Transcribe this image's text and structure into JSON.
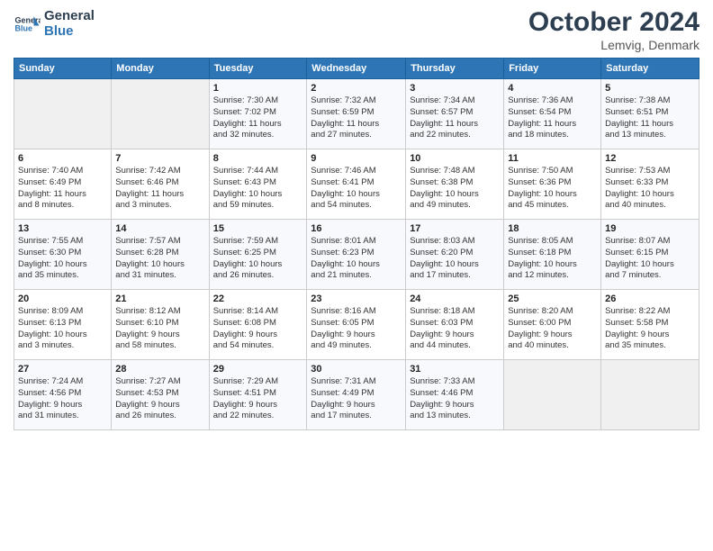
{
  "header": {
    "logo_line1": "General",
    "logo_line2": "Blue",
    "month": "October 2024",
    "location": "Lemvig, Denmark"
  },
  "weekdays": [
    "Sunday",
    "Monday",
    "Tuesday",
    "Wednesday",
    "Thursday",
    "Friday",
    "Saturday"
  ],
  "weeks": [
    [
      {
        "day": "",
        "info": ""
      },
      {
        "day": "",
        "info": ""
      },
      {
        "day": "1",
        "info": "Sunrise: 7:30 AM\nSunset: 7:02 PM\nDaylight: 11 hours\nand 32 minutes."
      },
      {
        "day": "2",
        "info": "Sunrise: 7:32 AM\nSunset: 6:59 PM\nDaylight: 11 hours\nand 27 minutes."
      },
      {
        "day": "3",
        "info": "Sunrise: 7:34 AM\nSunset: 6:57 PM\nDaylight: 11 hours\nand 22 minutes."
      },
      {
        "day": "4",
        "info": "Sunrise: 7:36 AM\nSunset: 6:54 PM\nDaylight: 11 hours\nand 18 minutes."
      },
      {
        "day": "5",
        "info": "Sunrise: 7:38 AM\nSunset: 6:51 PM\nDaylight: 11 hours\nand 13 minutes."
      }
    ],
    [
      {
        "day": "6",
        "info": "Sunrise: 7:40 AM\nSunset: 6:49 PM\nDaylight: 11 hours\nand 8 minutes."
      },
      {
        "day": "7",
        "info": "Sunrise: 7:42 AM\nSunset: 6:46 PM\nDaylight: 11 hours\nand 3 minutes."
      },
      {
        "day": "8",
        "info": "Sunrise: 7:44 AM\nSunset: 6:43 PM\nDaylight: 10 hours\nand 59 minutes."
      },
      {
        "day": "9",
        "info": "Sunrise: 7:46 AM\nSunset: 6:41 PM\nDaylight: 10 hours\nand 54 minutes."
      },
      {
        "day": "10",
        "info": "Sunrise: 7:48 AM\nSunset: 6:38 PM\nDaylight: 10 hours\nand 49 minutes."
      },
      {
        "day": "11",
        "info": "Sunrise: 7:50 AM\nSunset: 6:36 PM\nDaylight: 10 hours\nand 45 minutes."
      },
      {
        "day": "12",
        "info": "Sunrise: 7:53 AM\nSunset: 6:33 PM\nDaylight: 10 hours\nand 40 minutes."
      }
    ],
    [
      {
        "day": "13",
        "info": "Sunrise: 7:55 AM\nSunset: 6:30 PM\nDaylight: 10 hours\nand 35 minutes."
      },
      {
        "day": "14",
        "info": "Sunrise: 7:57 AM\nSunset: 6:28 PM\nDaylight: 10 hours\nand 31 minutes."
      },
      {
        "day": "15",
        "info": "Sunrise: 7:59 AM\nSunset: 6:25 PM\nDaylight: 10 hours\nand 26 minutes."
      },
      {
        "day": "16",
        "info": "Sunrise: 8:01 AM\nSunset: 6:23 PM\nDaylight: 10 hours\nand 21 minutes."
      },
      {
        "day": "17",
        "info": "Sunrise: 8:03 AM\nSunset: 6:20 PM\nDaylight: 10 hours\nand 17 minutes."
      },
      {
        "day": "18",
        "info": "Sunrise: 8:05 AM\nSunset: 6:18 PM\nDaylight: 10 hours\nand 12 minutes."
      },
      {
        "day": "19",
        "info": "Sunrise: 8:07 AM\nSunset: 6:15 PM\nDaylight: 10 hours\nand 7 minutes."
      }
    ],
    [
      {
        "day": "20",
        "info": "Sunrise: 8:09 AM\nSunset: 6:13 PM\nDaylight: 10 hours\nand 3 minutes."
      },
      {
        "day": "21",
        "info": "Sunrise: 8:12 AM\nSunset: 6:10 PM\nDaylight: 9 hours\nand 58 minutes."
      },
      {
        "day": "22",
        "info": "Sunrise: 8:14 AM\nSunset: 6:08 PM\nDaylight: 9 hours\nand 54 minutes."
      },
      {
        "day": "23",
        "info": "Sunrise: 8:16 AM\nSunset: 6:05 PM\nDaylight: 9 hours\nand 49 minutes."
      },
      {
        "day": "24",
        "info": "Sunrise: 8:18 AM\nSunset: 6:03 PM\nDaylight: 9 hours\nand 44 minutes."
      },
      {
        "day": "25",
        "info": "Sunrise: 8:20 AM\nSunset: 6:00 PM\nDaylight: 9 hours\nand 40 minutes."
      },
      {
        "day": "26",
        "info": "Sunrise: 8:22 AM\nSunset: 5:58 PM\nDaylight: 9 hours\nand 35 minutes."
      }
    ],
    [
      {
        "day": "27",
        "info": "Sunrise: 7:24 AM\nSunset: 4:56 PM\nDaylight: 9 hours\nand 31 minutes."
      },
      {
        "day": "28",
        "info": "Sunrise: 7:27 AM\nSunset: 4:53 PM\nDaylight: 9 hours\nand 26 minutes."
      },
      {
        "day": "29",
        "info": "Sunrise: 7:29 AM\nSunset: 4:51 PM\nDaylight: 9 hours\nand 22 minutes."
      },
      {
        "day": "30",
        "info": "Sunrise: 7:31 AM\nSunset: 4:49 PM\nDaylight: 9 hours\nand 17 minutes."
      },
      {
        "day": "31",
        "info": "Sunrise: 7:33 AM\nSunset: 4:46 PM\nDaylight: 9 hours\nand 13 minutes."
      },
      {
        "day": "",
        "info": ""
      },
      {
        "day": "",
        "info": ""
      }
    ]
  ]
}
